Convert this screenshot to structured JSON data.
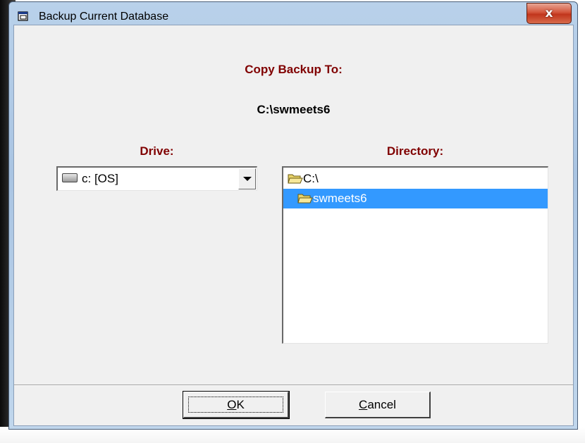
{
  "window": {
    "title": "Backup Current Database",
    "close_glyph": "x"
  },
  "dialog": {
    "copy_heading": "Copy Backup To:",
    "target_path": "C:\\swmeets6",
    "drive_label": "Drive:",
    "directory_label": "Directory:"
  },
  "drive_select": {
    "selected_value": "c: [OS]",
    "icon": "drive-icon"
  },
  "directory_list": {
    "items": [
      {
        "label": "C:\\",
        "icon": "folder-open-icon",
        "selected": false
      },
      {
        "label": "swmeets6",
        "icon": "folder-open-icon",
        "selected": true
      }
    ]
  },
  "buttons": {
    "ok_label": "OK",
    "cancel_label": "Cancel"
  },
  "colors": {
    "heading": "#800000",
    "selection": "#3399ff",
    "close_button": "#c1351c"
  }
}
